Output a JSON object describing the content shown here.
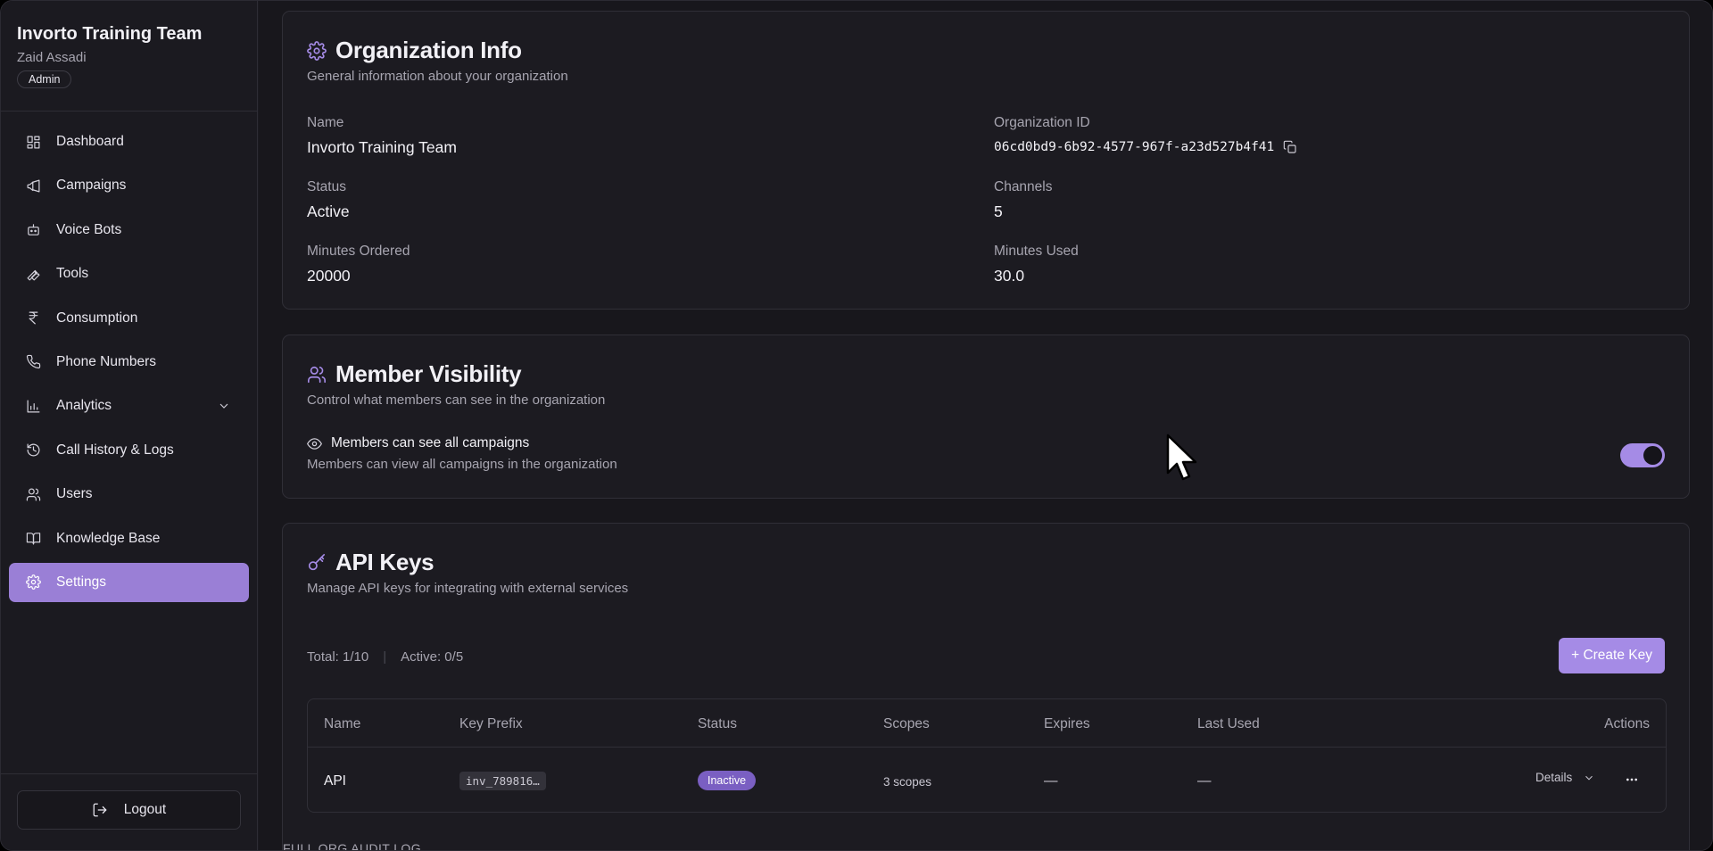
{
  "sidebar": {
    "org_name": "Invorto Training Team",
    "user_name": "Zaid Assadi",
    "role": "Admin",
    "items": [
      {
        "label": "Dashboard",
        "icon": "dashboard-icon"
      },
      {
        "label": "Campaigns",
        "icon": "megaphone-icon"
      },
      {
        "label": "Voice Bots",
        "icon": "bot-icon"
      },
      {
        "label": "Tools",
        "icon": "wrench-icon"
      },
      {
        "label": "Consumption",
        "icon": "rupee-icon"
      },
      {
        "label": "Phone Numbers",
        "icon": "phone-icon"
      },
      {
        "label": "Analytics",
        "icon": "bar-chart-icon"
      },
      {
        "label": "Call History & Logs",
        "icon": "history-icon"
      },
      {
        "label": "Users",
        "icon": "users-icon"
      },
      {
        "label": "Knowledge Base",
        "icon": "book-icon"
      },
      {
        "label": "Settings",
        "icon": "gear-icon"
      }
    ],
    "active_item": "Settings",
    "logout_label": "Logout"
  },
  "org_info": {
    "title": "Organization Info",
    "subtitle": "General information about your organization",
    "name_label": "Name",
    "name_value": "Invorto Training Team",
    "org_id_label": "Organization ID",
    "org_id_value": "06cd0bd9-6b92-4577-967f-a23d527b4f41",
    "status_label": "Status",
    "status_value": "Active",
    "channels_label": "Channels",
    "channels_value": "5",
    "minutes_ordered_label": "Minutes Ordered",
    "minutes_ordered_value": "20000",
    "minutes_used_label": "Minutes Used",
    "minutes_used_value": "30.0"
  },
  "member_visibility": {
    "title": "Member Visibility",
    "subtitle": "Control what members can see in the organization",
    "setting_label": "Members can see all campaigns",
    "setting_desc": "Members can view all campaigns in the organization",
    "enabled": true
  },
  "api_keys": {
    "title": "API Keys",
    "subtitle": "Manage API keys for integrating with external services",
    "total": "Total: 1/10",
    "active": "Active: 0/5",
    "create_label": "+ Create Key",
    "columns": [
      "Name",
      "Key Prefix",
      "Status",
      "Scopes",
      "Expires",
      "Last Used",
      "Actions"
    ],
    "rows": [
      {
        "name": "API",
        "prefix": "inv_789816…",
        "status": "Inactive",
        "scopes": "3 scopes",
        "expires": "—",
        "last_used": "—",
        "details": "Details"
      }
    ]
  },
  "audit": {
    "label": "FULL ORG AUDIT LOG"
  },
  "colors": {
    "accent": "#a58be6",
    "active_nav": "#9a7fd6",
    "background": "#18171c"
  }
}
